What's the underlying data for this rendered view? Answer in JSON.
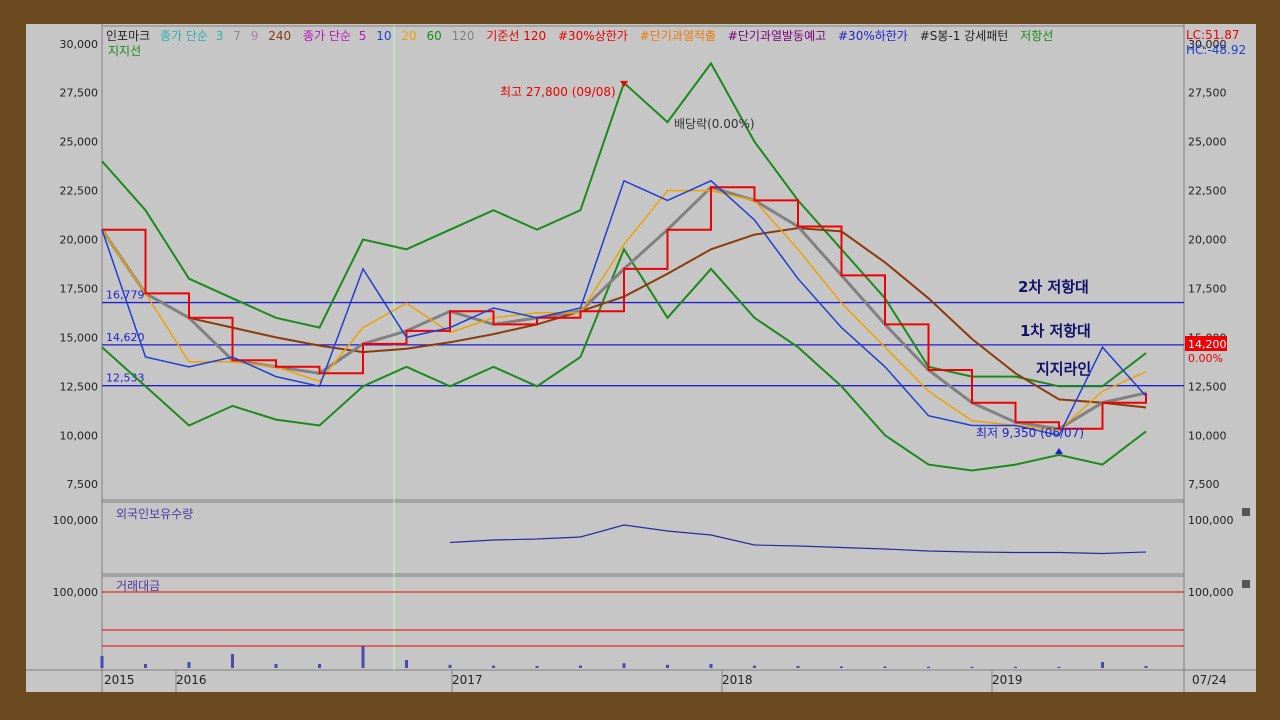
{
  "legend": {
    "name": "인포마크",
    "ma_label": "종가 단순",
    "ma_periods1": [
      "3",
      "7",
      "9",
      "240"
    ],
    "ma_label2": "종가 단순",
    "ma_periods2": [
      "5",
      "10",
      "20",
      "60",
      "120"
    ],
    "base": "기준선 120",
    "upper": "#30%상한가",
    "overheat": "#단기과열적출",
    "overheat_warn": "#단기과열발동예고",
    "lower": "#30%하한가",
    "pattern": "#S봉-1 강세패턴",
    "resistance": "저항선",
    "support": "지지선",
    "lc": "LC:51.87",
    "hc": "HC:-48.92"
  },
  "annotations": {
    "high": "최고 27,800 (09/08)",
    "low": "최저 9,350 (06/07)",
    "dividend": "배당락(0.00%)",
    "res2": "2차 저항대",
    "res1": "1차 저항대",
    "support_line": "지지라인",
    "price_box": "14,200",
    "pct_box": "0.00%"
  },
  "hlines": [
    {
      "label": "16,779",
      "value": 16779
    },
    {
      "label": "14,620",
      "value": 14620
    },
    {
      "label": "12,533",
      "value": 12533
    }
  ],
  "yticks_main": [
    {
      "label": "30,000",
      "v": 30000
    },
    {
      "label": "27,500",
      "v": 27500
    },
    {
      "label": "25,000",
      "v": 25000
    },
    {
      "label": "22,500",
      "v": 22500
    },
    {
      "label": "20,000",
      "v": 20000
    },
    {
      "label": "17,500",
      "v": 17500
    },
    {
      "label": "15,000",
      "v": 15000
    },
    {
      "label": "12,500",
      "v": 12500
    },
    {
      "label": "10,000",
      "v": 10000
    },
    {
      "label": "7,500",
      "v": 7500
    }
  ],
  "panel2": {
    "title": "외국인보유수량",
    "tick": "100,000"
  },
  "panel3": {
    "title": "거래대금",
    "tick": "100,000"
  },
  "xticks": [
    "2015",
    "2016",
    "2017",
    "2018",
    "2019"
  ],
  "date_label": "07/24",
  "colors": {
    "price": "#1f3fd0",
    "band": "#1a8a1a",
    "ma_orange": "#f0a000",
    "ma_gray": "#808080",
    "ma_brown": "#8b3a0a",
    "resist": "#ee0000",
    "hline": "#1f1fd0",
    "annot": "#10106a"
  },
  "chart_data": {
    "type": "line",
    "title": "인포마크",
    "x": [
      "2015-12",
      "2016-01",
      "2016-03",
      "2016-05",
      "2016-07",
      "2016-09",
      "2016-10",
      "2016-12",
      "2017-02",
      "2017-04",
      "2017-06",
      "2017-08",
      "2017-09",
      "2017-11",
      "2018-01",
      "2018-03",
      "2018-05",
      "2018-07",
      "2018-09",
      "2018-11",
      "2019-01",
      "2019-03",
      "2019-05",
      "2019-06",
      "2019-07"
    ],
    "ylim": [
      7000,
      30500
    ],
    "series": [
      {
        "name": "종가",
        "values": [
          20500,
          14000,
          13500,
          14000,
          13000,
          12500,
          18500,
          15000,
          15500,
          16500,
          16000,
          16500,
          23000,
          22000,
          23000,
          21000,
          18000,
          15500,
          13500,
          11000,
          10500,
          10500,
          10000,
          14500,
          12000
        ]
      },
      {
        "name": "지지선",
        "values": [
          14500,
          12500,
          10500,
          11500,
          10800,
          10500,
          12500,
          13500,
          12500,
          13500,
          12500,
          14000,
          19500,
          16000,
          18500,
          16000,
          14500,
          12500,
          10000,
          8500,
          8200,
          8500,
          9000,
          8500,
          10200
        ]
      },
      {
        "name": "저항선",
        "values": [
          24000,
          21500,
          18000,
          17000,
          16000,
          15500,
          20000,
          19500,
          20500,
          21500,
          20500,
          21500,
          28000,
          26000,
          29000,
          25000,
          22000,
          19500,
          17000,
          13500,
          13000,
          13000,
          12500,
          12500,
          14200
        ]
      }
    ],
    "hlines": [
      16779,
      14620,
      12533
    ],
    "high": {
      "label": "최고 27,800 (09/08)",
      "value": 27800
    },
    "low": {
      "label": "최저 9,350 (06/07)",
      "value": 9350
    },
    "volume_panel": {
      "title": "외국인보유수량",
      "tick": "100,000"
    },
    "amount_panel": {
      "title": "거래대금",
      "tick": "100,000"
    }
  }
}
